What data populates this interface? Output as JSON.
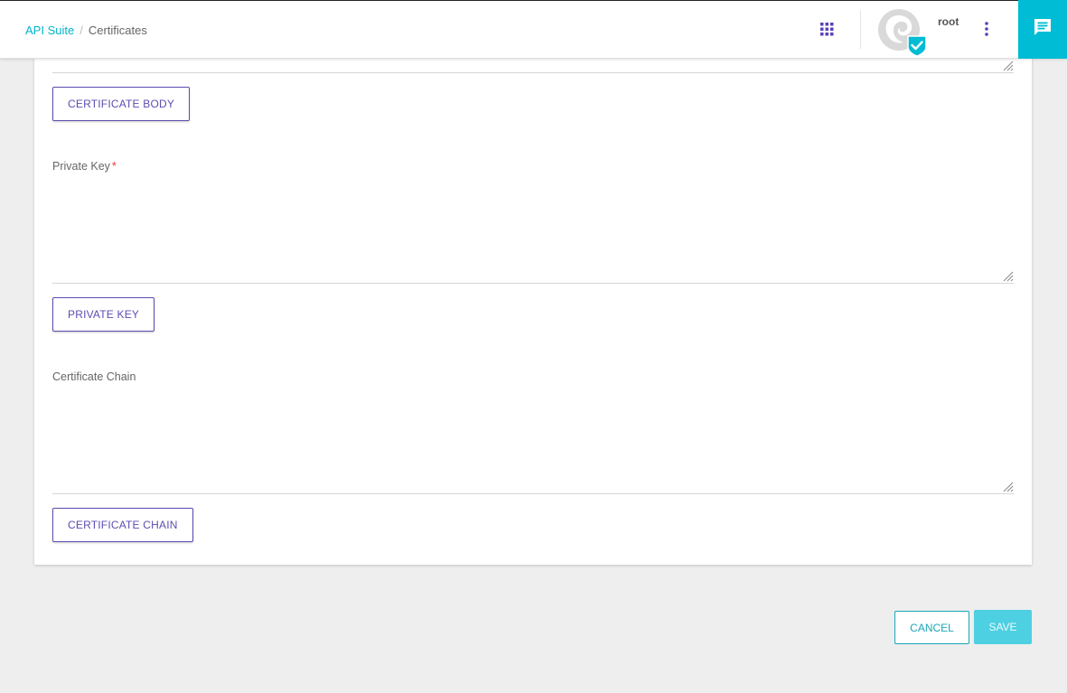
{
  "breadcrumb": {
    "parent": "API Suite",
    "separator": "/",
    "current": "Certificates"
  },
  "header": {
    "apps_icon": "grid-apps-icon",
    "username": "root",
    "menu_icon": "more-vertical-icon",
    "chat_icon": "chat-message-icon"
  },
  "form": {
    "certificate_body": {
      "button_label": "CERTIFICATE BODY",
      "value": ""
    },
    "private_key": {
      "label": "Private Key",
      "required_mark": "*",
      "value": "",
      "button_label": "PRIVATE KEY"
    },
    "certificate_chain": {
      "label": "Certificate Chain",
      "value": "",
      "button_label": "CERTIFICATE CHAIN"
    }
  },
  "actions": {
    "cancel_label": "CANCEL",
    "save_label": "SAVE"
  },
  "colors": {
    "accent": "#00bcd4",
    "primary": "#5c4db1",
    "save_bg": "#4dd0e1",
    "required": "#e53935"
  }
}
